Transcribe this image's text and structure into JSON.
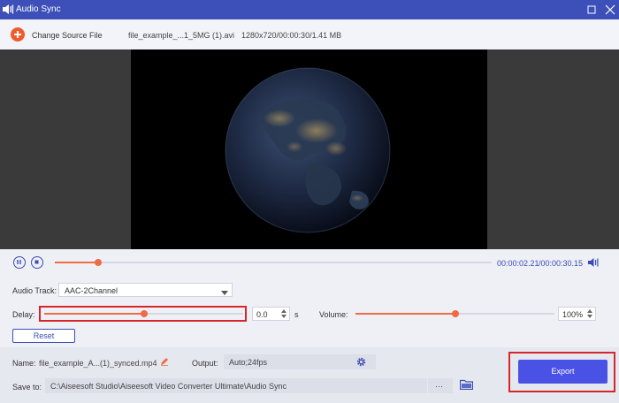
{
  "window": {
    "title": "Audio Sync"
  },
  "source": {
    "change_label": "Change Source File",
    "file_name": "file_example_...1_5MG (1).avi",
    "file_info": "1280x720/00:00:30/1.41 MB"
  },
  "playback": {
    "current_time": "00:00:02.21",
    "total_time": "/00:00:30.15",
    "progress_fraction": 0.1
  },
  "audio": {
    "track_label": "Audio Track:",
    "track_value": "AAC-2Channel",
    "delay_label": "Delay:",
    "delay_value": "0.0",
    "delay_unit": "s",
    "delay_fraction": 0.5,
    "volume_label": "Volume:",
    "volume_value": "100%",
    "volume_fraction": 0.5,
    "reset_label": "Reset"
  },
  "output": {
    "name_label": "Name:",
    "name_value": "file_example_A...(1)_synced.mp4",
    "output_label": "Output:",
    "output_value": "Auto;24fps",
    "save_label": "Save to:",
    "save_path": "C:\\Aiseesoft Studio\\Aiseesoft Video Converter Ultimate\\Audio Sync",
    "browse_label": "···",
    "export_label": "Export"
  },
  "icons": {
    "app": "audio-sync-icon",
    "maximize": "maximize-icon",
    "close": "close-icon",
    "add": "plus-icon",
    "pause": "pause-icon",
    "stop": "stop-icon",
    "volume": "speaker-icon",
    "caret": "chevron-down-icon",
    "edit": "pencil-icon",
    "settings": "gear-icon",
    "folder": "folder-icon"
  },
  "colors": {
    "titlebar": "#3d4fb8",
    "accent": "#f06a44",
    "primary": "#4a52e6",
    "highlight": "#d6262c"
  }
}
